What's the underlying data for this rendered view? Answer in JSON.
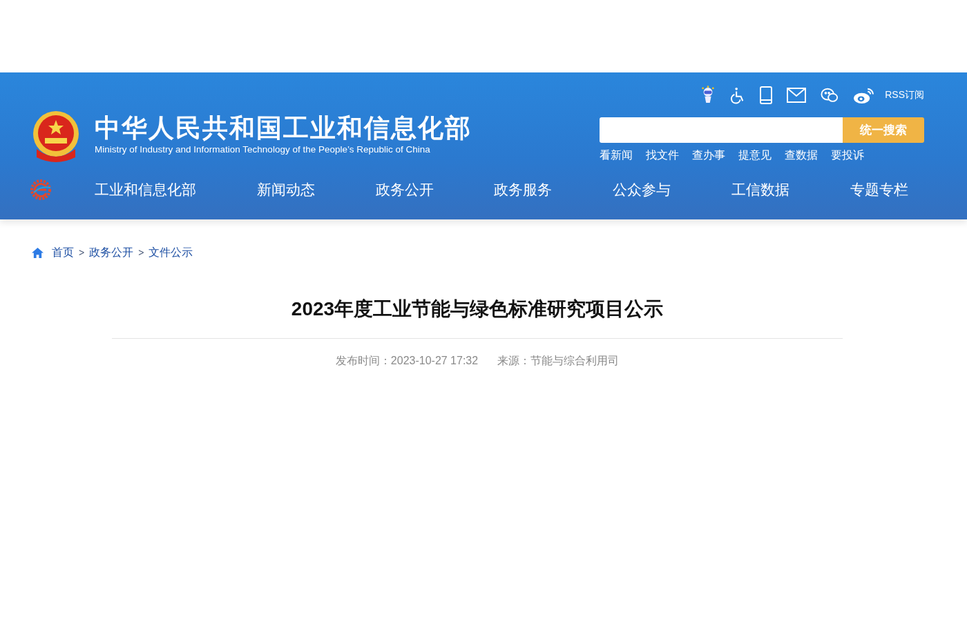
{
  "header": {
    "title": "中华人民共和国工业和信息化部",
    "subtitle": "Ministry of Industry and Information Technology of the People’s Republic of China",
    "rss": "RSS订阅",
    "search": {
      "button": "统一搜索"
    },
    "quick_links": [
      "看新闻",
      "找文件",
      "查办事",
      "提意见",
      "查数据",
      "要投诉"
    ]
  },
  "nav": [
    "工业和信息化部",
    "新闻动态",
    "政务公开",
    "政务服务",
    "公众参与",
    "工信数据",
    "专题专栏"
  ],
  "breadcrumb": [
    {
      "kind": "link",
      "text": "首页"
    },
    {
      "kind": "sep",
      "text": ">"
    },
    {
      "kind": "link",
      "text": "政务公开"
    },
    {
      "kind": "sep",
      "text": ">"
    },
    {
      "kind": "link",
      "text": "文件公示"
    }
  ],
  "article": {
    "title": "2023年度工业节能与绿色标准研究项目公示",
    "published": "发布时间：2023-10-27 17:32",
    "source": "来源：节能与综合利用司"
  }
}
